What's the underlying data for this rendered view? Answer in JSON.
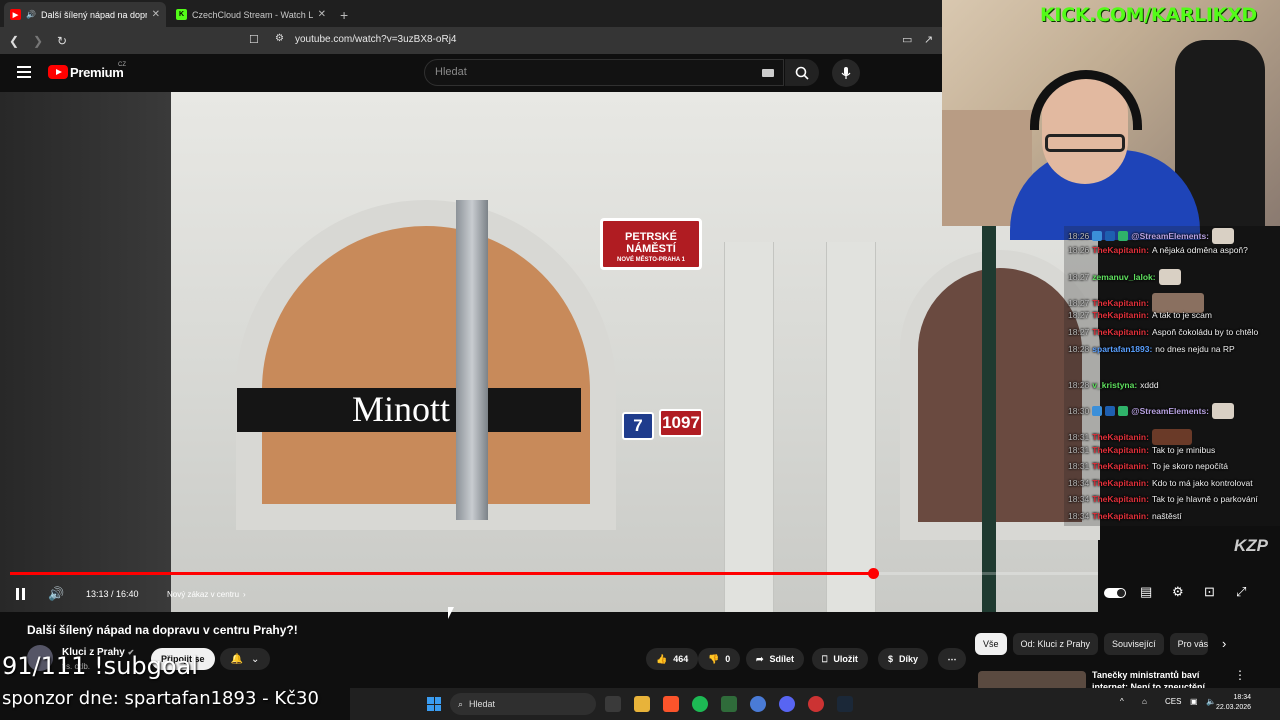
{
  "browser": {
    "tabs": [
      {
        "title": "Další šílený nápad na dopravu",
        "active": true
      },
      {
        "title": "CzechCloud Stream - Watch Live on Kick",
        "active": false
      }
    ],
    "url": "youtube.com/watch?v=3uzBX8-oRj4"
  },
  "masthead": {
    "brand": "Premium",
    "country": "CZ",
    "search_placeholder": "Hledat"
  },
  "video": {
    "title": "Další šílený nápad na dopravu v centru Prahy?!",
    "current_time": "13:13",
    "duration": "16:40",
    "time_display": "13:13 / 16:40",
    "chapter": "Nový zákaz v centru",
    "progress_fraction": 0.793,
    "scene": {
      "store_sign": "Minott",
      "street_sign_line1": "PETRSKÉ NÁMĚSTÍ",
      "street_sign_line2": "NOVÉ MĚSTO-PRAHA 1",
      "number_blue": "7",
      "number_red": "1097"
    }
  },
  "channel": {
    "name": "Kluci z Prahy",
    "subs": "tis. odb.",
    "join_label": "Připojit se"
  },
  "actions": {
    "likes": "464",
    "dislikes": "0",
    "share": "Sdílet",
    "save": "Uložit",
    "thanks": "Díky"
  },
  "chips": [
    "Vše",
    "Od: Kluci z Prahy",
    "Související",
    "Pro vás"
  ],
  "recommended": {
    "title": "Tanečky ministrantů baví internet: Není to zneuctění"
  },
  "stream": {
    "kick_url": "KICK.COM/KARLIKXD",
    "subgoal": "91/111 !subgoal",
    "sponsor": "sponzor dne: spartafan1893 - Kč30",
    "watermark": "KZP"
  },
  "chat": [
    {
      "time": "18:26",
      "user": "@StreamElements:",
      "user_color": "#b9a3e3",
      "text": "",
      "emote": "small"
    },
    {
      "time": "18:26",
      "user": "TheKapitanin:",
      "user_color": "#e0303a",
      "text": "A nějaká odměna aspoň?"
    },
    {
      "time": "18:27",
      "user": "zemanuv_lalok:",
      "user_color": "#5fe05f",
      "text": "",
      "emote": "small"
    },
    {
      "time": "18:27",
      "user": "TheKapitanin:",
      "user_color": "#e0303a",
      "text": "",
      "emote": "big"
    },
    {
      "time": "18:27",
      "user": "TheKapitanin:",
      "user_color": "#e0303a",
      "text": "A tak to je scam"
    },
    {
      "time": "18:27",
      "user": "TheKapitanin:",
      "user_color": "#e0303a",
      "text": "Aspoň čokoládu by to chtělo"
    },
    {
      "time": "18:28",
      "user": "spartafan1893:",
      "user_color": "#5aa0ff",
      "text": "no dnes nejdu na RP"
    },
    {
      "time": "18:28",
      "user": "v_kristyna:",
      "user_color": "#5fe05f",
      "text": "xddd"
    },
    {
      "time": "18:30",
      "user": "@StreamElements:",
      "user_color": "#b9a3e3",
      "text": "",
      "emote": "small"
    },
    {
      "time": "18:31",
      "user": "TheKapitanin:",
      "user_color": "#e0303a",
      "text": "",
      "emote": "dark"
    },
    {
      "time": "18:31",
      "user": "TheKapitanin:",
      "user_color": "#e0303a",
      "text": "Tak to je minibus"
    },
    {
      "time": "18:31",
      "user": "TheKapitanin:",
      "user_color": "#e0303a",
      "text": "To je skoro nepočítá"
    },
    {
      "time": "18:34",
      "user": "TheKapitanin:",
      "user_color": "#e0303a",
      "text": "Kdo to má jako kontrolovat"
    },
    {
      "time": "18:34",
      "user": "TheKapitanin:",
      "user_color": "#e0303a",
      "text": "Tak to je hlavně o parkování"
    },
    {
      "time": "18:34",
      "user": "TheKapitanin:",
      "user_color": "#e0303a",
      "text": "naštěstí"
    }
  ],
  "taskbar": {
    "search_placeholder": "Hledat",
    "lang": "CES",
    "time": "18:34",
    "date": "22.03.2026"
  }
}
